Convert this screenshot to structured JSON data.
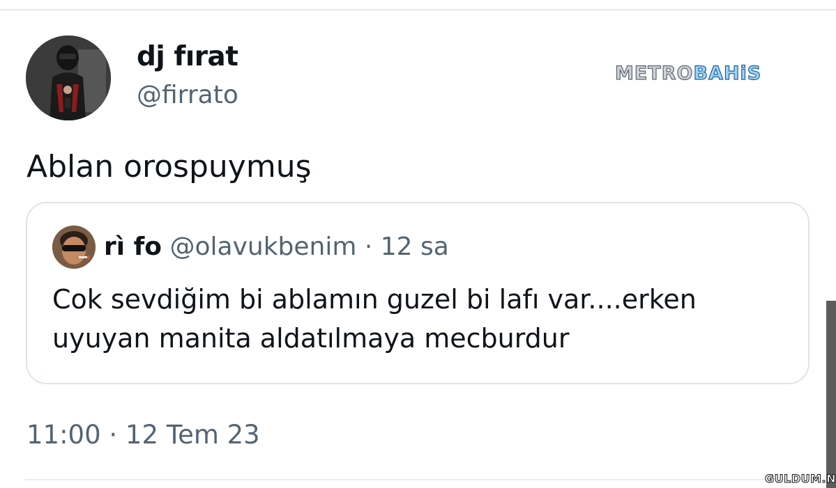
{
  "author": {
    "display_name": "dj fırat",
    "handle": "@firrato"
  },
  "watermark": {
    "brand_left": "METRO",
    "brand_right": "BAHiS",
    "corner": "GULDUM.NET"
  },
  "tweet": {
    "text": "Ablan orospuymuş",
    "timestamp": "11:00 · 12 Tem 23"
  },
  "quoted_tweet": {
    "display_name": "rì fo",
    "meta": "@olavukbenim · 12 sa",
    "text": "Cok sevdiğim bi ablamın guzel bi lafı var....erken uyuyan manita aldatılmaya mecburdur"
  },
  "colors": {
    "text_primary": "#0f1419",
    "text_secondary": "#536471",
    "border": "#dfe4e8"
  }
}
